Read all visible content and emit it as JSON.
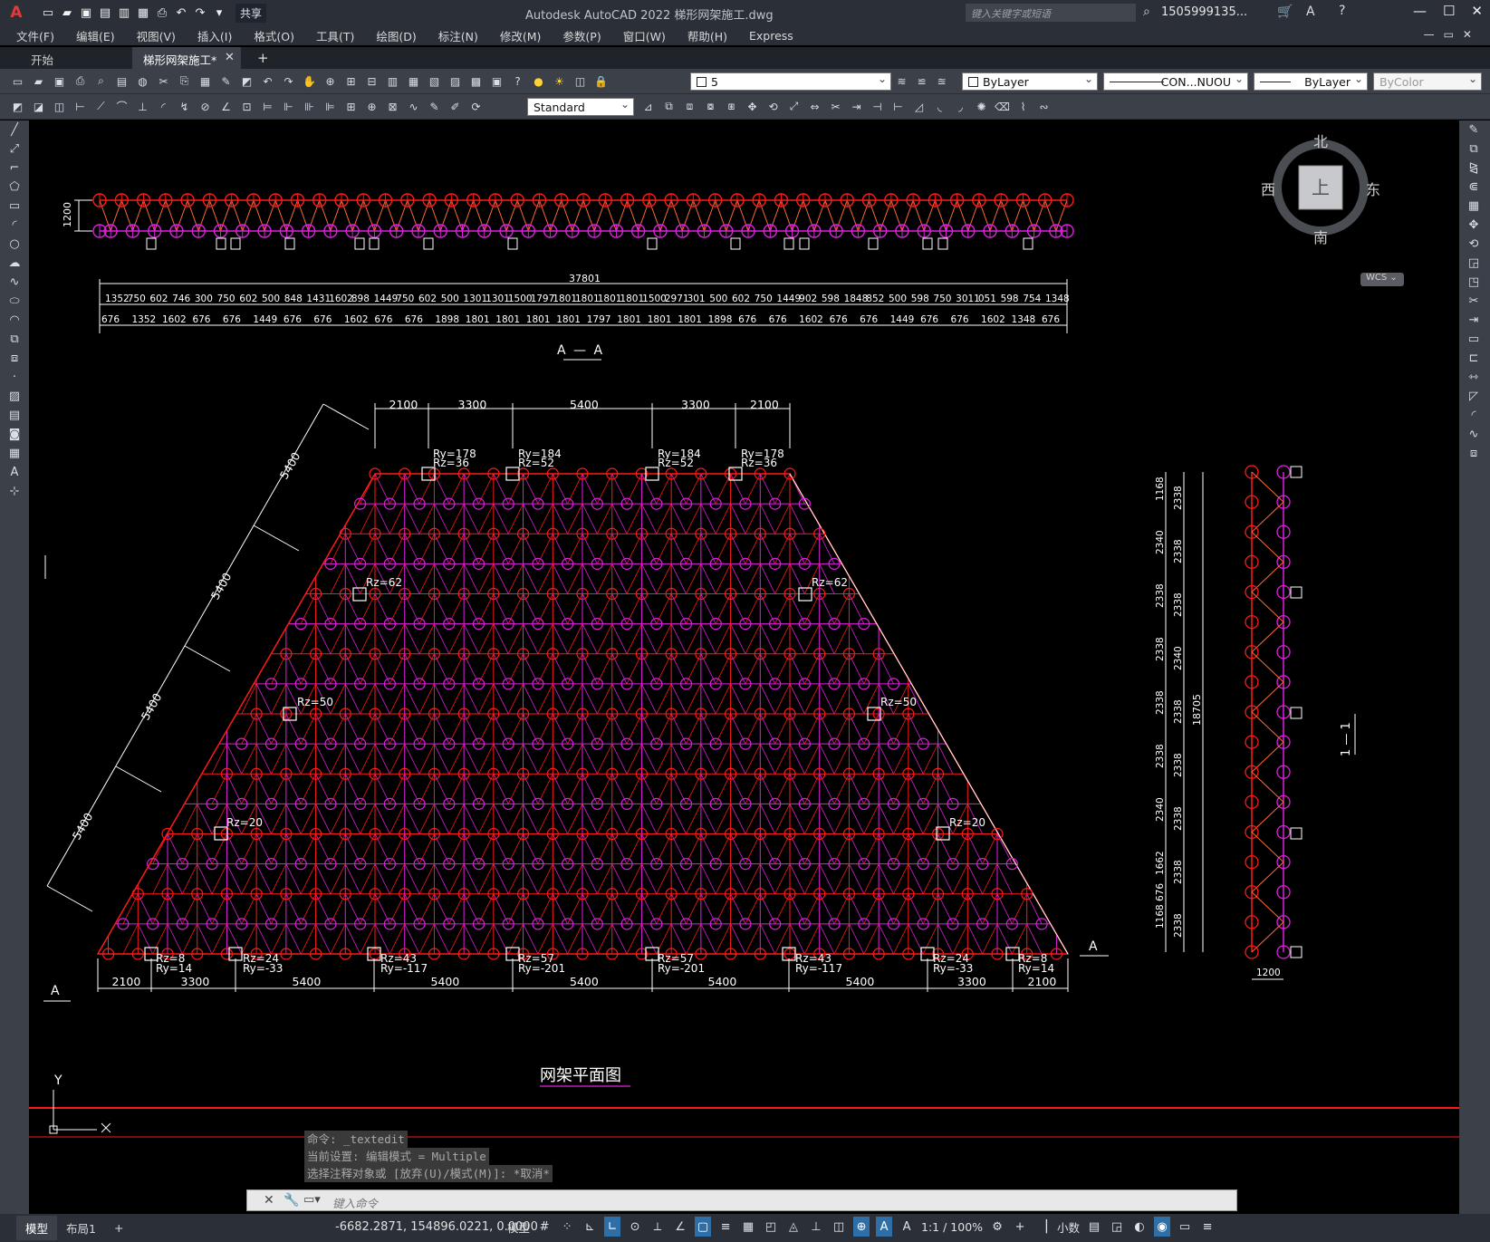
{
  "app": {
    "logo": "A",
    "title": "Autodesk AutoCAD 2022    梯形网架施工.dwg",
    "share": "共享",
    "search_placeholder": "键入关键字或短语",
    "user": "1505999135...",
    "window_controls": [
      "—",
      "☐",
      "✕"
    ]
  },
  "menu": [
    "文件(F)",
    "编辑(E)",
    "视图(V)",
    "插入(I)",
    "格式(O)",
    "工具(T)",
    "绘图(D)",
    "标注(N)",
    "修改(M)",
    "参数(P)",
    "窗口(W)",
    "帮助(H)",
    "Express"
  ],
  "doc_tabs": {
    "start": "开始",
    "active": "梯形网架施工*",
    "add": "+"
  },
  "toolbar": {
    "layer_value": "5",
    "color_value": "ByLayer",
    "linetype_value": "CON...NUOU",
    "lineweight_value": "ByLayer",
    "plotstyle_value": "ByColor",
    "textstyle_value": "Standard"
  },
  "viewcube": {
    "north": "北",
    "south": "南",
    "west": "西",
    "east": "东",
    "top": "上",
    "wcs": "WCS"
  },
  "drawing": {
    "section_title": "A — A",
    "overall_dim": "37801",
    "top_dims_row1": [
      "1352",
      "750",
      "602",
      "746",
      "300",
      "750",
      "602",
      "500",
      "848",
      "1431",
      "1602",
      "898",
      "1449",
      "750",
      "602",
      "500",
      "1301",
      "1301",
      "1500",
      "1797",
      "1801",
      "1801",
      "1801",
      "1801",
      "1500",
      "2971",
      "301",
      "500",
      "602",
      "750",
      "1449",
      "902",
      "598",
      "1848",
      "852",
      "500",
      "598",
      "750",
      "3011",
      "051",
      "598",
      "754",
      "1348"
    ],
    "top_dims_row2": [
      "676",
      "1352",
      "1602",
      "676",
      "676",
      "1449",
      "676",
      "676",
      "1602",
      "676",
      "676",
      "1898",
      "1801",
      "1801",
      "1801",
      "1801",
      "1797",
      "1801",
      "1801",
      "1801",
      "1898",
      "676",
      "676",
      "1602",
      "676",
      "676",
      "1449",
      "676",
      "676",
      "1602",
      "1348",
      "676"
    ],
    "section_height": "1200",
    "plan_top_dims": [
      "2100",
      "3300",
      "5400",
      "3300",
      "2100"
    ],
    "plan_bottom_dims": [
      "2100",
      "3300",
      "5400",
      "5400",
      "5400",
      "5400",
      "5400",
      "3300",
      "2100"
    ],
    "slope_dims": [
      "5400",
      "5400",
      "5400",
      "5400"
    ],
    "support_labels_top": [
      [
        "Ry=178",
        "Rz=36"
      ],
      [
        "Ry=184",
        "Rz=52"
      ],
      [
        "Ry=184",
        "Rz=52"
      ],
      [
        "Ry=178",
        "Rz=36"
      ]
    ],
    "support_labels_side": [
      "Rz=62",
      "Rz=62",
      "Rz=50",
      "Rz=50",
      "Rz=20",
      "Rz=20"
    ],
    "support_labels_bottom": [
      [
        "Rz=8",
        "Ry=14"
      ],
      [
        "Rz=24",
        "Ry=-33"
      ],
      [
        "Rz=43",
        "Ry=-117"
      ],
      [
        "Rz=57",
        "Ry=-201"
      ],
      [
        "Rz=57",
        "Ry=-201"
      ],
      [
        "Rz=43",
        "Ry=-117"
      ],
      [
        "Rz=24",
        "Ry=-33"
      ],
      [
        "Rz=8",
        "Ry=14"
      ]
    ],
    "section_mark": "A",
    "right_dims_outer": [
      "1168",
      "2340",
      "2338",
      "2338",
      "2338",
      "2338",
      "2340",
      "1662",
      "1168 676"
    ],
    "right_dims_inner": [
      "2338",
      "2338",
      "2338",
      "2340",
      "2338",
      "2338",
      "2338",
      "2338",
      "2338"
    ],
    "right_total": "18705",
    "right_width": "1200",
    "side_section_title": "1 — 1",
    "plan_title": "网架平面图",
    "ucs_y": "Y"
  },
  "command": {
    "history": [
      "命令: _textedit",
      "当前设置: 编辑模式 = Multiple",
      "选择注释对象或 [放弃(U)/模式(M)]: *取消*"
    ],
    "placeholder": "键入命令"
  },
  "status": {
    "tabs": [
      "模型",
      "布局1",
      "+"
    ],
    "coords": "-6682.2871, 154896.0221, 0.0000",
    "mode": "模型",
    "scale": "1:1 / 100%",
    "units": "小数"
  },
  "colors": {
    "top_chord": "#ff1a1a",
    "bottom_chord": "#e020e0",
    "web": "#ff6a3a",
    "dims": "#ffffff",
    "accent": "#2f6fa8"
  }
}
